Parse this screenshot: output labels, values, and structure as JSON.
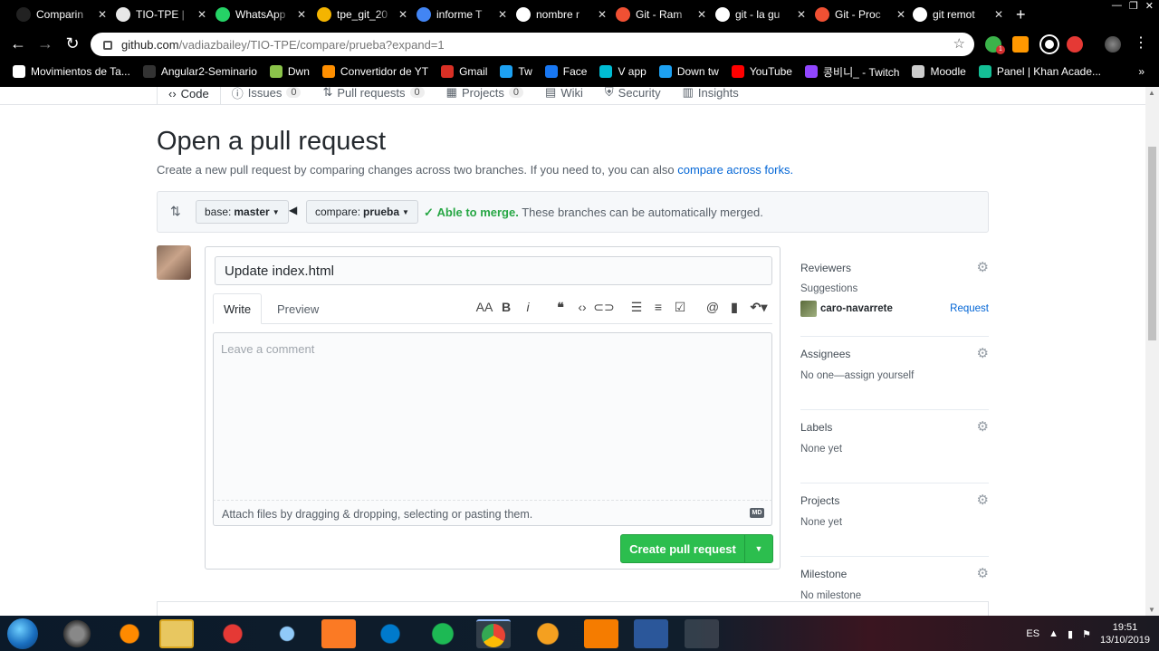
{
  "browser": {
    "tabs": [
      {
        "title": "Comparin",
        "color": "#222"
      },
      {
        "title": "TIO-TPE |",
        "color": "#e8e8e8"
      },
      {
        "title": "WhatsApp",
        "color": "#25d366"
      },
      {
        "title": "tpe_git_20",
        "color": "#f4b400"
      },
      {
        "title": "informe T",
        "color": "#4285f4"
      },
      {
        "title": "nombre r",
        "color": "#fff"
      },
      {
        "title": "Git - Ram",
        "color": "#f05033"
      },
      {
        "title": "git - la gu",
        "color": "#fff"
      },
      {
        "title": "Git - Proc",
        "color": "#f05033"
      },
      {
        "title": "git remot",
        "color": "#fff"
      }
    ],
    "new_tab": "+",
    "url_host": "github.com",
    "url_path": "/vadiazbailey/TIO-TPE/compare/prueba?expand=1",
    "extension_badge": "1",
    "bookmarks": [
      {
        "label": "Movimientos de Ta...",
        "color": "#fff"
      },
      {
        "label": "Angular2-Seminario",
        "color": "#333"
      },
      {
        "label": "Dwn",
        "color": "#8bc34a"
      },
      {
        "label": "Convertidor de YT",
        "color": "#ff8f00"
      },
      {
        "label": "Gmail",
        "color": "#d93025"
      },
      {
        "label": "Tw",
        "color": "#1da1f2"
      },
      {
        "label": "Face",
        "color": "#1877f2"
      },
      {
        "label": "V app",
        "color": "#00bcd4"
      },
      {
        "label": "Down tw",
        "color": "#1da1f2"
      },
      {
        "label": "YouTube",
        "color": "#ff0000"
      },
      {
        "label": "콩비니_ - Twitch",
        "color": "#9146ff"
      },
      {
        "label": "Moodle",
        "color": "#ccc"
      },
      {
        "label": "Panel | Khan Acade...",
        "color": "#14bf96"
      }
    ],
    "more_bookmarks": "»"
  },
  "repo_nav": {
    "tabs": [
      {
        "label": "Code",
        "count": ""
      },
      {
        "label": "Issues",
        "count": "0"
      },
      {
        "label": "Pull requests",
        "count": "0"
      },
      {
        "label": "Projects",
        "count": "0"
      },
      {
        "label": "Wiki",
        "count": ""
      },
      {
        "label": "Security",
        "count": ""
      },
      {
        "label": "Insights",
        "count": ""
      }
    ]
  },
  "page": {
    "title": "Open a pull request",
    "subtitle": "Create a new pull request by comparing changes across two branches. If you need to, you can also",
    "subtitle_link": "compare across forks."
  },
  "compare": {
    "base_prefix": "base:",
    "base_branch": "master",
    "compare_prefix": "compare:",
    "compare_branch": "prueba",
    "merge_ok": "Able to merge.",
    "merge_text": "These branches can be automatically merged."
  },
  "form": {
    "title_value": "Update index.html",
    "tab_write": "Write",
    "tab_preview": "Preview",
    "comment_placeholder": "Leave a comment",
    "attach_text": "Attach files by dragging & dropping, selecting or pasting them.",
    "md_badge": "MD",
    "submit_label": "Create pull request"
  },
  "sidebar": {
    "reviewers": {
      "heading": "Reviewers",
      "sub": "Suggestions",
      "user": "caro-navarrete",
      "action": "Request"
    },
    "assignees": {
      "heading": "Assignees",
      "value": "No one—assign yourself"
    },
    "labels": {
      "heading": "Labels",
      "value": "None yet"
    },
    "projects": {
      "heading": "Projects",
      "value": "None yet"
    },
    "milestone": {
      "heading": "Milestone",
      "value": "No milestone"
    }
  },
  "taskbar": {
    "lang": "ES",
    "time": "19:51",
    "date": "13/10/2019"
  }
}
